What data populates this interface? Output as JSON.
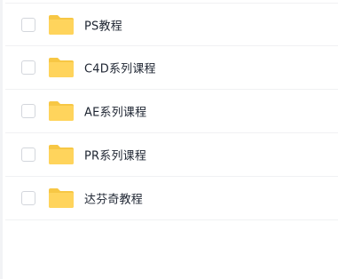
{
  "files": [
    {
      "name": "PS教程",
      "icon": "folder-icon"
    },
    {
      "name": "C4D系列课程",
      "icon": "folder-icon"
    },
    {
      "name": "AE系列课程",
      "icon": "folder-icon"
    },
    {
      "name": "PR系列课程",
      "icon": "folder-icon"
    },
    {
      "name": "达芬奇教程",
      "icon": "folder-icon"
    }
  ],
  "colors": {
    "folder": "#ffd45c",
    "folder_tab": "#f7c744",
    "text": "#1e2532",
    "divider": "#f0f1f3",
    "checkbox_border": "#d3d6dc"
  }
}
